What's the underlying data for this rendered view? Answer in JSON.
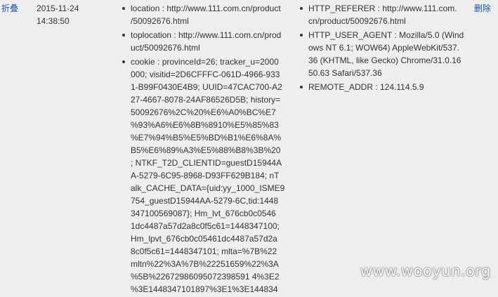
{
  "row": {
    "collapse_label": "折叠",
    "date": "2015-11-24",
    "time": "14:38:50",
    "delete_label": "删除"
  },
  "request": [
    {
      "text": "location : http://www.111.com.cn/product\n/50092676.html"
    },
    {
      "text": "toplocation : http://www.111.com.cn/prod\nuct/50092676.html"
    },
    {
      "text": "cookie : provinceId=26; tracker_u=2000\n000; visitid=2D6CFFFC-061D-4966-933\n1-B99F0430E4B9; UUID=47CAC700-A2\n27-4667-8078-24AF86526D5B; history=\n50092676%2C%20%E6%A0%BC%E7\n%93%A6%E6%8B%8910%E5%85%83\n%E7%94%B5%E5%BD%B1%E6%8A%\nB5%E6%89%A3%E5%88%B8%3B%20\n; NTKF_T2D_CLIENTID=guestD15944A\nA-5279-6C95-8968-D93FF629B184; nT\nalk_CACHE_DATA={uid:yy_1000_ISME9\n754_guestD15944AA-5279-6C,tid:1448\n347100569087}; Hm_lvt_676cb0c0546\n1dc4487a57d2a8c0f5c61=1448347100;\nHm_lpvt_676cb0c05461dc4487a57d2a\n8c0f5c61=1448347101; mlta=%7B%22\nmltn%22%3A%7B%22251659%22%3A\n%5B%22672986095072398591 4%3E2\n%3E1448347101897%3E1%3E144834"
    }
  ],
  "server": [
    {
      "text": "HTTP_REFERER : http://www.111.com.\ncn/product/50092676.html"
    },
    {
      "text": "HTTP_USER_AGENT : Mozilla/5.0 (Wind\nows NT 6.1; WOW64) AppleWebKit/537.\n36 (KHTML, like Gecko) Chrome/31.0.16\n50.63 Safari/537.36"
    },
    {
      "text": "REMOTE_ADDR : 124.114.5.9"
    }
  ],
  "watermark": "www.wooyun.org"
}
